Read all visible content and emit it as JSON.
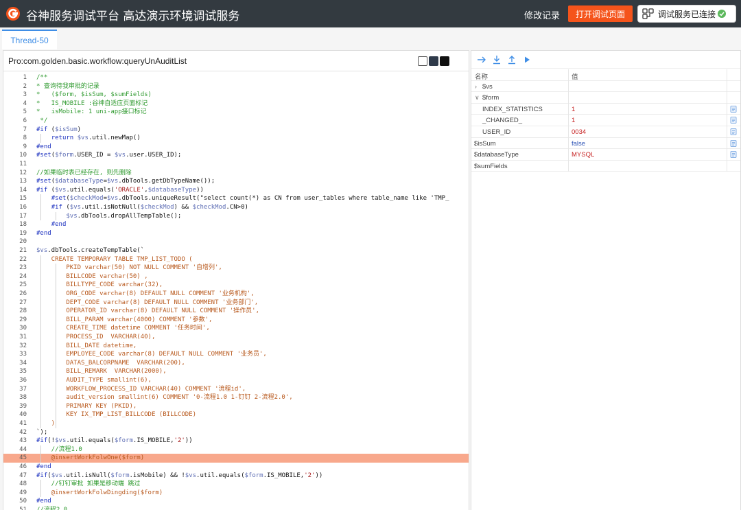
{
  "header": {
    "app_title": "谷神服务调试平台 高达演示环境调试服务",
    "history_label": "修改记录",
    "open_page_label": "打开调试页面",
    "connected_label": "调试服务已连接",
    "brand_color": "#f5541b"
  },
  "tabs": [
    {
      "label": "Thread-50",
      "active": true
    }
  ],
  "editor": {
    "title": "Pro:com.golden.basic.workflow:queryUnAuditList",
    "themes": [
      "light",
      "dark",
      "black"
    ],
    "highlight_line": 45,
    "lines": [
      {
        "n": "1",
        "t": "/**",
        "k": "com"
      },
      {
        "n": "2",
        "t": "* 查询待我审批的记录",
        "k": "com"
      },
      {
        "n": "3",
        "t": "*   ($form, $isSum, $sumFields)",
        "k": "com"
      },
      {
        "n": "4",
        "t": "*   IS_MOBILE :谷神自适应页面标记",
        "k": "com"
      },
      {
        "n": "5",
        "t": "*   isMobile: 1 uni-app接口标记",
        "k": "com"
      },
      {
        "n": "6",
        "t": " */",
        "k": "com"
      },
      {
        "n": "7",
        "t": "#if ($isSum)",
        "k": "kw"
      },
      {
        "n": "8",
        "t": "    return $vs.util.newMap()",
        "k": "ret"
      },
      {
        "n": "9",
        "t": "#end",
        "k": "kw"
      },
      {
        "n": "10",
        "t": "#set($form.USER_ID = $vs.user.USER_ID);",
        "k": "set"
      },
      {
        "n": "11",
        "t": "",
        "k": ""
      },
      {
        "n": "12",
        "t": "//如果临时表已经存在, 则先删除",
        "k": "com"
      },
      {
        "n": "13",
        "t": "#set($databaseType=$vs.dbTools.getDbTypeName());",
        "k": "set"
      },
      {
        "n": "14",
        "t": "#if ($vs.util.equals('ORACLE',$databaseType))",
        "k": "set"
      },
      {
        "n": "15",
        "t": "    #set($checkMod=$vs.dbTools.uniqueResult(\"select count(*) as CN from user_tables where table_name like 'TMP_",
        "k": "set"
      },
      {
        "n": "16",
        "t": "    #if ($vs.util.isNotNull($checkMod) && $checkMod.CN>0)",
        "k": "set"
      },
      {
        "n": "17",
        "t": "        $vs.dbTools.dropAllTempTable();",
        "k": "set"
      },
      {
        "n": "18",
        "t": "    #end",
        "k": "kw"
      },
      {
        "n": "19",
        "t": "#end",
        "k": "kw"
      },
      {
        "n": "20",
        "t": "",
        "k": ""
      },
      {
        "n": "21",
        "t": "$vs.dbTools.createTempTable(`",
        "k": "set"
      },
      {
        "n": "22",
        "t": "    CREATE TEMPORARY TABLE TMP_LIST_TODO (",
        "k": "blk"
      },
      {
        "n": "23",
        "t": "        PKID varchar(50) NOT NULL COMMENT '自增列',",
        "k": "blk"
      },
      {
        "n": "24",
        "t": "        BILLCODE varchar(50) ,",
        "k": "blk"
      },
      {
        "n": "25",
        "t": "        BILLTYPE_CODE varchar(32),",
        "k": "blk"
      },
      {
        "n": "26",
        "t": "        ORG_CODE varchar(8) DEFAULT NULL COMMENT '业务机构',",
        "k": "blk"
      },
      {
        "n": "27",
        "t": "        DEPT_CODE varchar(8) DEFAULT NULL COMMENT '业务部门',",
        "k": "blk"
      },
      {
        "n": "28",
        "t": "        OPERATOR_ID varchar(8) DEFAULT NULL COMMENT '操作员',",
        "k": "blk"
      },
      {
        "n": "29",
        "t": "        BILL_PARAM varchar(4000) COMMENT '参数',",
        "k": "blk"
      },
      {
        "n": "30",
        "t": "        CREATE_TIME datetime COMMENT '任务时间',",
        "k": "blk"
      },
      {
        "n": "31",
        "t": "        PROCESS_ID  VARCHAR(40),",
        "k": "blk"
      },
      {
        "n": "32",
        "t": "        BILL_DATE datetime,",
        "k": "blk"
      },
      {
        "n": "33",
        "t": "        EMPLOYEE_CODE varchar(8) DEFAULT NULL COMMENT '业务员',",
        "k": "blk"
      },
      {
        "n": "34",
        "t": "        DATAS_BALCORPNAME  VARCHAR(200),",
        "k": "blk"
      },
      {
        "n": "35",
        "t": "        BILL_REMARK  VARCHAR(2000),",
        "k": "blk"
      },
      {
        "n": "36",
        "t": "        AUDIT_TYPE smallint(6),",
        "k": "blk"
      },
      {
        "n": "37",
        "t": "        WORKFLOW_PROCESS_ID VARCHAR(40) COMMENT '流程id',",
        "k": "blk"
      },
      {
        "n": "38",
        "t": "        audit_version smallint(6) COMMENT '0-流程1.0 1-钉钉 2-流程2.0',",
        "k": "blk"
      },
      {
        "n": "39",
        "t": "        PRIMARY KEY (PKID),",
        "k": "blk"
      },
      {
        "n": "40",
        "t": "        KEY IX_TMP_LIST_BILLCODE (BILLCODE)",
        "k": "blk"
      },
      {
        "n": "41",
        "t": "    )",
        "k": "blk"
      },
      {
        "n": "42",
        "t": "`);",
        "k": ""
      },
      {
        "n": "43",
        "t": "#if(!$vs.util.equals($form.IS_MOBILE,'2'))",
        "k": "set"
      },
      {
        "n": "44",
        "t": "    //流程1.0",
        "k": "com"
      },
      {
        "n": "45",
        "t": "    @insertWorkFolwOne($form)",
        "k": "at"
      },
      {
        "n": "46",
        "t": "#end",
        "k": "kw"
      },
      {
        "n": "47",
        "t": "#if($vs.util.isNull($form.isMobile) && !$vs.util.equals($form.IS_MOBILE,'2'))",
        "k": "set"
      },
      {
        "n": "48",
        "t": "    //钉钉审批 如果是移动端 跳过",
        "k": "com"
      },
      {
        "n": "49",
        "t": "    @insertWorkFolwDingding($form)",
        "k": "at"
      },
      {
        "n": "50",
        "t": "#end",
        "k": "kw"
      },
      {
        "n": "51",
        "t": "//流程2.0",
        "k": "com"
      }
    ]
  },
  "debugger": {
    "toolbar": [
      "step-over-icon",
      "step-into-icon",
      "step-out-icon",
      "resume-icon"
    ],
    "col_name": "名称",
    "col_value": "值",
    "variables": [
      {
        "name": "$vs",
        "value": "",
        "level": 0,
        "expand": "collapsed",
        "color": "red",
        "copy": false
      },
      {
        "name": "$form",
        "value": "",
        "level": 0,
        "expand": "expanded",
        "color": "red",
        "copy": false
      },
      {
        "name": "INDEX_STATISTICS",
        "value": "1",
        "level": 1,
        "expand": "none",
        "color": "red",
        "copy": true
      },
      {
        "name": "_CHANGED_",
        "value": "1",
        "level": 1,
        "expand": "none",
        "color": "red",
        "copy": true
      },
      {
        "name": "USER_ID",
        "value": "0034",
        "level": 1,
        "expand": "none",
        "color": "red",
        "copy": true
      },
      {
        "name": "$isSum",
        "value": "false",
        "level": 0,
        "expand": "none",
        "color": "blue",
        "copy": true
      },
      {
        "name": "$databaseType",
        "value": "MYSQL",
        "level": 0,
        "expand": "none",
        "color": "red",
        "copy": true
      },
      {
        "name": "$sumFields",
        "value": "",
        "level": 0,
        "expand": "none",
        "color": "red",
        "copy": false
      }
    ]
  }
}
